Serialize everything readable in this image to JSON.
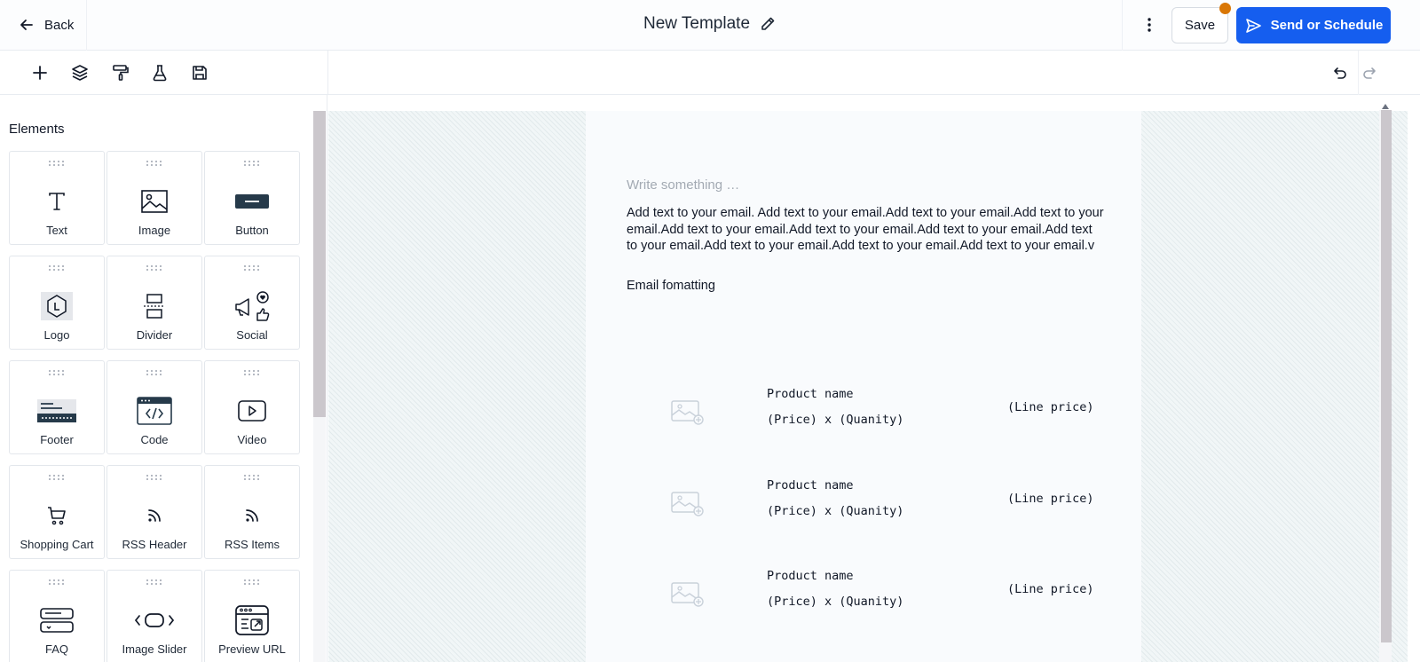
{
  "header": {
    "back_label": "Back",
    "title": "New Template",
    "save_label": "Save",
    "send_label": "Send or Schedule",
    "accent_color": "#155eef",
    "notification_dot_color": "#d97706"
  },
  "toolbar": {
    "tools": [
      "plus-icon",
      "layers-icon",
      "paint-roller-icon",
      "flask-icon",
      "save-disk-icon"
    ],
    "undo_icon": "undo-icon",
    "redo_icon": "redo-icon"
  },
  "sidebar": {
    "heading": "Elements",
    "elements": [
      {
        "label": "Text",
        "icon": "text-icon"
      },
      {
        "label": "Image",
        "icon": "image-icon"
      },
      {
        "label": "Button",
        "icon": "button-icon"
      },
      {
        "label": "Logo",
        "icon": "logo-icon"
      },
      {
        "label": "Divider",
        "icon": "divider-icon"
      },
      {
        "label": "Social",
        "icon": "social-icon"
      },
      {
        "label": "Footer",
        "icon": "footer-icon"
      },
      {
        "label": "Code",
        "icon": "code-icon"
      },
      {
        "label": "Video",
        "icon": "video-icon"
      },
      {
        "label": "Shopping Cart",
        "icon": "shopping-cart-icon"
      },
      {
        "label": "RSS Header",
        "icon": "rss-icon"
      },
      {
        "label": "RSS Items",
        "icon": "rss-icon"
      },
      {
        "label": "FAQ",
        "icon": "faq-icon"
      },
      {
        "label": "Image Slider",
        "icon": "image-slider-icon"
      },
      {
        "label": "Preview URL",
        "icon": "preview-url-icon"
      }
    ]
  },
  "email": {
    "placeholder": "Write something …",
    "body": "Add text to your email. Add text to your email.Add text to your email.Add text to your email.Add text to your email.Add text to your email.Add text to your email.Add text to your email.Add text to your email.Add text to your email.Add text to your email.v",
    "formatting_text": "Email fomatting",
    "products": [
      {
        "name": "Product name",
        "qty": "(Price) x (Quanity)",
        "line_price": "(Line price)"
      },
      {
        "name": "Product name",
        "qty": "(Price) x (Quanity)",
        "line_price": "(Line price)"
      },
      {
        "name": "Product name",
        "qty": "(Price) x (Quanity)",
        "line_price": "(Line price)"
      }
    ]
  }
}
